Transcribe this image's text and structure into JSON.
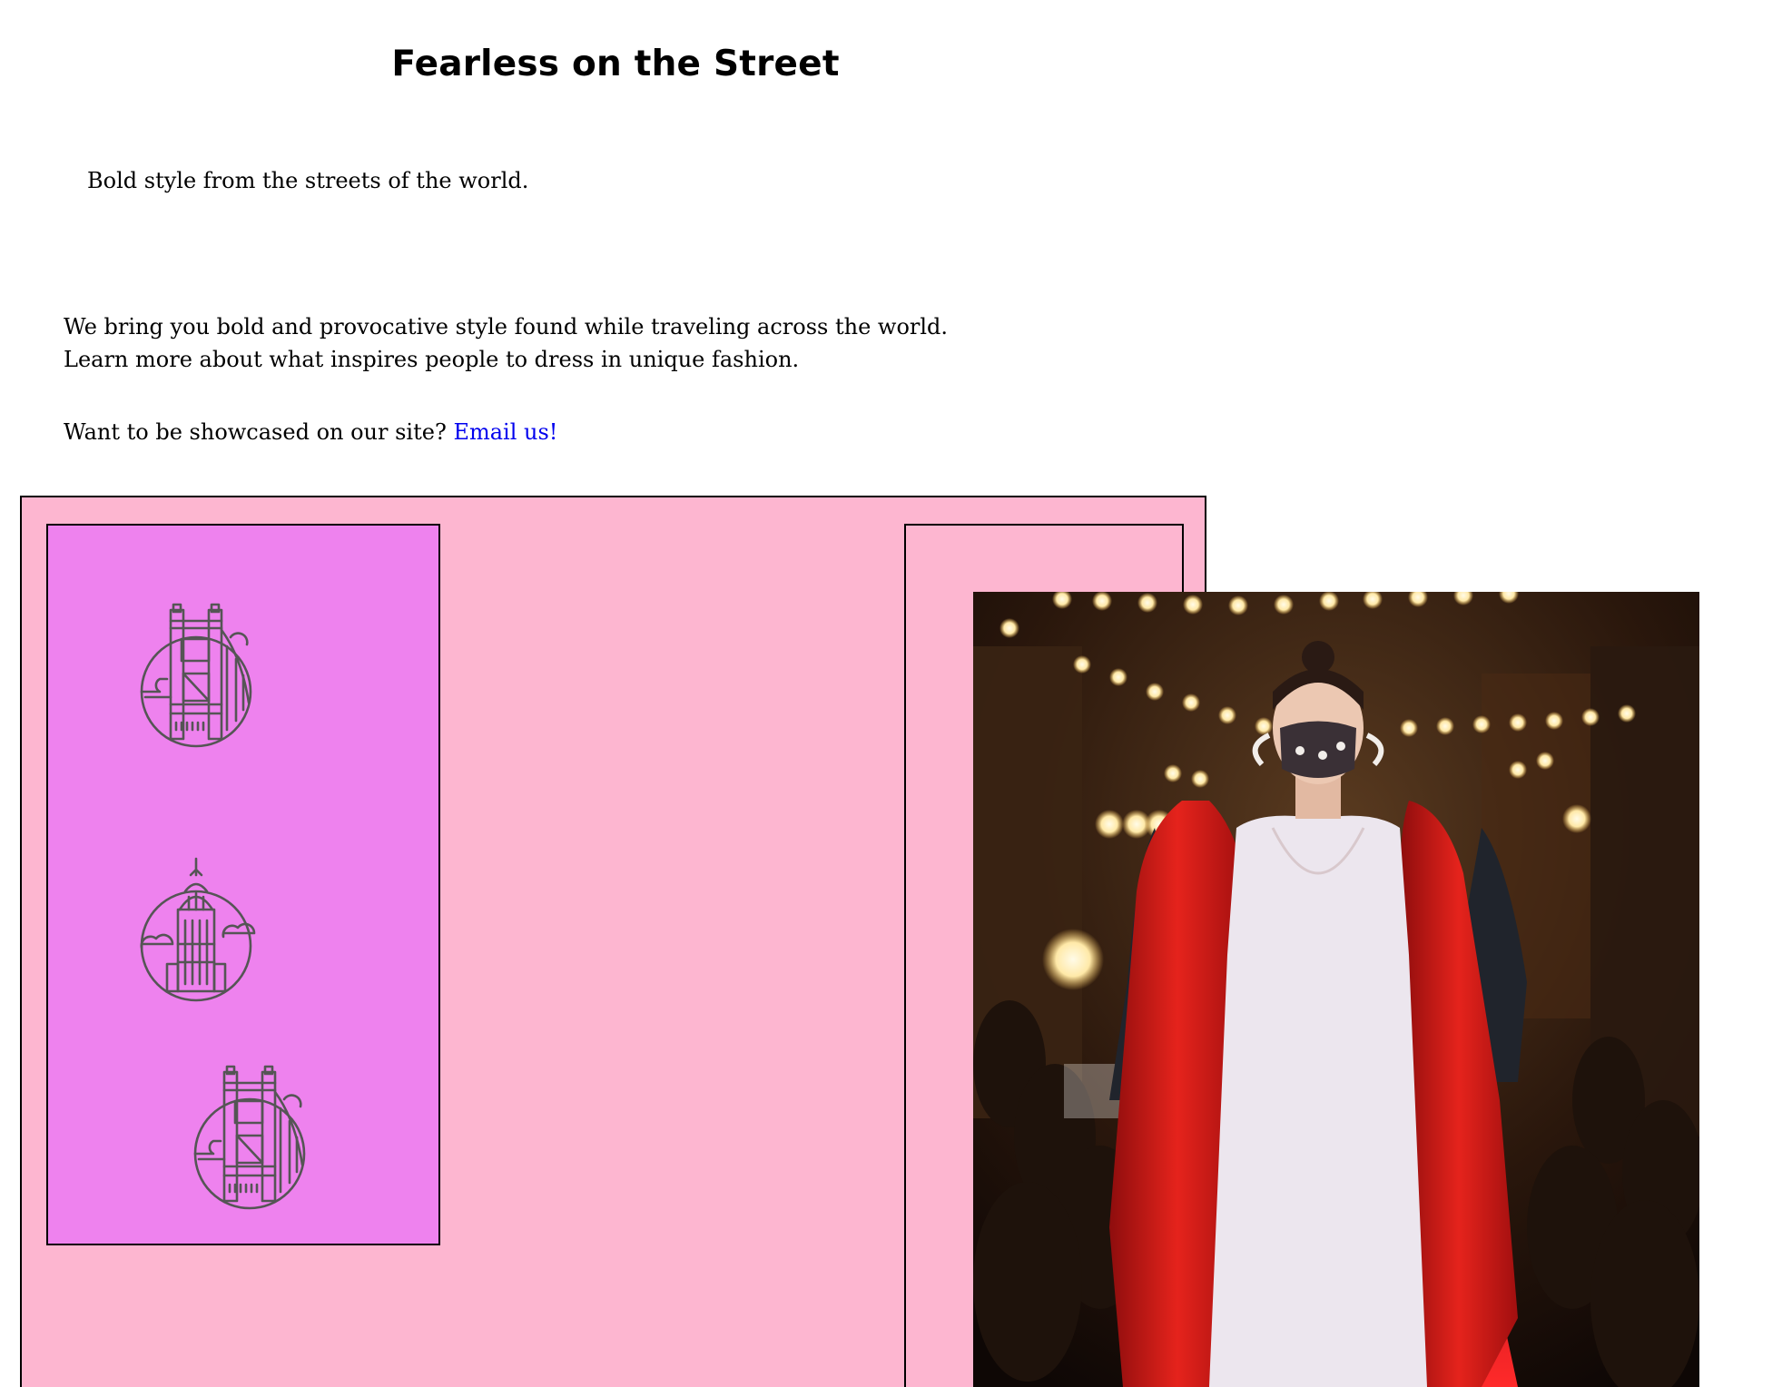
{
  "header": {
    "title": "Fearless on the Street",
    "tagline": "Bold style from the streets of the world."
  },
  "intro": {
    "line1": "We bring you bold and provocative style found while traveling across the world.",
    "line2": "Learn more about what inspires people to dress in unique fashion."
  },
  "cta": {
    "text": "Want to be showcased on our site?",
    "link_label": "Email us!"
  },
  "showcase": {
    "icons": [
      "bridge-icon",
      "skyscraper-icon",
      "bridge-icon"
    ],
    "photo": "runway-model-photo"
  },
  "colors": {
    "showcase_bg": "#fdb6d0",
    "icon_panel_bg": "#ee82ee",
    "icon_stroke": "#555555",
    "link": "#0000ee"
  }
}
